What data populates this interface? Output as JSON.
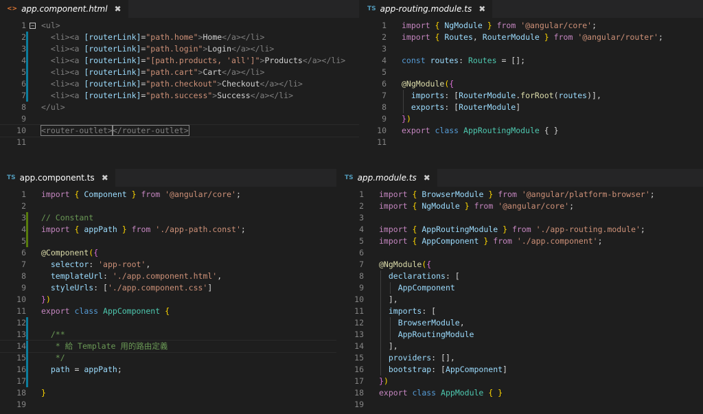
{
  "panes": {
    "top_left": {
      "tab": {
        "icon": "<>",
        "name": "app.component.html",
        "close": "✖"
      }
    },
    "top_right": {
      "tab": {
        "icon": "TS",
        "name": "app-routing.module.ts",
        "close": "✖"
      }
    },
    "bottom_left": {
      "tab": {
        "icon": "TS",
        "name": "app.component.ts",
        "close": "✖"
      }
    },
    "bottom_right": {
      "tab": {
        "icon": "TS",
        "name": "app.module.ts",
        "close": "✖"
      }
    }
  },
  "line_numbers": {
    "top_left": [
      "1",
      "2",
      "3",
      "4",
      "5",
      "6",
      "7",
      "8",
      "9",
      "10",
      "11"
    ],
    "top_right": [
      "1",
      "2",
      "3",
      "4",
      "5",
      "6",
      "7",
      "8",
      "9",
      "10",
      "11"
    ],
    "bottom_left": [
      "1",
      "2",
      "3",
      "4",
      "5",
      "6",
      "7",
      "8",
      "9",
      "10",
      "11",
      "12",
      "13",
      "14",
      "15",
      "16",
      "17",
      "18",
      "19"
    ],
    "bottom_right": [
      "1",
      "2",
      "3",
      "4",
      "5",
      "6",
      "7",
      "8",
      "9",
      "10",
      "11",
      "12",
      "13",
      "14",
      "15",
      "16",
      "17",
      "18",
      "19"
    ]
  },
  "code": {
    "html": {
      "l1_open": "<ul>",
      "li_open": "<li><a ",
      "li_close": "</a></li>",
      "attr": "[routerLink]",
      "eq": "=",
      "gt": ">",
      "home_val": "\"path.home\"",
      "home_text": "Home",
      "login_val": "\"path.login\"",
      "login_text": "Login",
      "products_val": "\"[path.products, 'all']\"",
      "products_text": "Products",
      "cart_val": "\"path.cart\"",
      "cart_text": "Cart",
      "checkout_val": "\"path.checkout\"",
      "checkout_text": "Checkout",
      "success_val": "\"path.success\"",
      "success_text": "Success",
      "l8_close": "</ul>",
      "l10_open": "<router-outlet>",
      "l10_close": "</router-outlet>"
    },
    "routing": {
      "import": "import",
      "from": "from",
      "l1_names": "NgModule",
      "l1_src": "'@angular/core'",
      "l2_names_a": "Routes",
      "l2_names_b": "RouterModule",
      "l2_src": "'@angular/router'",
      "l4_const": "const",
      "l4_name": "routes",
      "l4_type": "Routes",
      "l4_rest": " = [];",
      "l6_dec": "@NgModule",
      "l7_key": "imports",
      "l7_mod": "RouterModule",
      "l7_fn": "forRoot",
      "l7_arg": "routes",
      "l8_key": "exports",
      "l8_mod": "RouterModule",
      "l10_export": "export",
      "l10_class": "class",
      "l10_name": "AppRoutingModule",
      "l10_rest": " { }"
    },
    "component": {
      "l1_names": "Component",
      "l1_src": "'@angular/core'",
      "l3_comment": "// Constant",
      "l4_names": "appPath",
      "l4_src": "'./app-path.const'",
      "l6_dec": "@Component",
      "l7_key": "selector",
      "l7_val": "'app-root'",
      "l8_key": "templateUrl",
      "l8_val": "'./app.component.html'",
      "l9_key": "styleUrls",
      "l9_val": "'./app.component.css'",
      "l11_name": "AppComponent",
      "l13_c": "/**",
      "l14_c": " * 給 Template 用的路由定義",
      "l15_c": " */",
      "l16_key": "path",
      "l16_val": "appPath"
    },
    "module": {
      "l1_names": "BrowserModule",
      "l1_src": "'@angular/platform-browser'",
      "l2_names": "NgModule",
      "l2_src": "'@angular/core'",
      "l4_names": "AppRoutingModule",
      "l4_src": "'./app-routing.module'",
      "l5_names": "AppComponent",
      "l5_src": "'./app.component'",
      "l7_dec": "@NgModule",
      "l8_key": "declarations",
      "l9_item": "AppComponent",
      "l11_key": "imports",
      "l12_item": "BrowserModule",
      "l13_item": "AppRoutingModule",
      "l15_key": "providers",
      "l16_key": "bootstrap",
      "l16_item": "AppComponent",
      "l18_name": "AppModule"
    }
  }
}
